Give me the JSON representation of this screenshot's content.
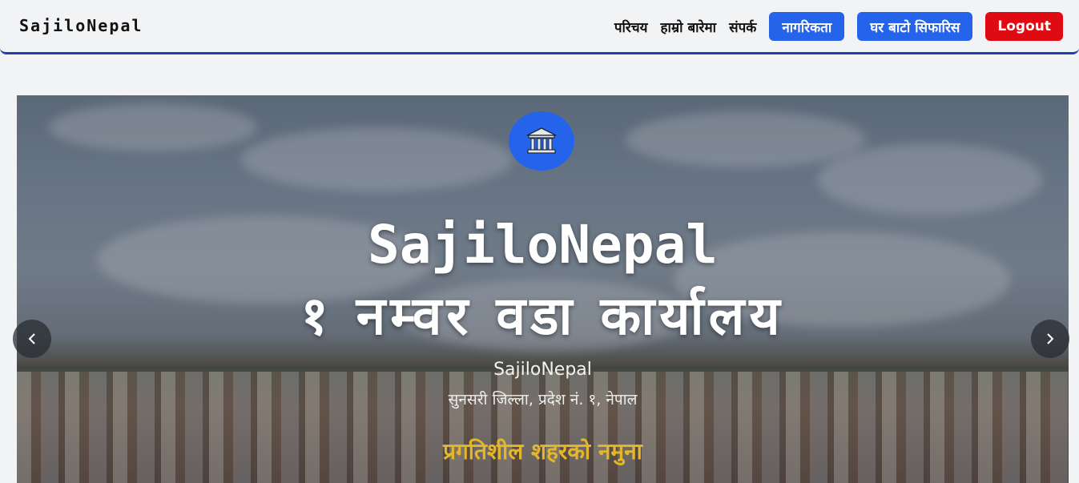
{
  "brand": "SajiloNepal",
  "nav": {
    "links": [
      "परिचय",
      "हाम्रो बारेमा",
      "संपर्क"
    ],
    "buttons": {
      "citizenship": "नागरिकता",
      "house_road": "घर बाटो सिफारिस",
      "logout": "Logout"
    }
  },
  "hero": {
    "emblem_icon": "government-building-icon",
    "title": "SajiloNepal",
    "subtitle": "१ नम्वर वडा कार्यालय",
    "name": "SajiloNepal",
    "address": "सुनसरी जिल्ला, प्रदेश नं. १, नेपाल",
    "tagline": "प्रगतिशील शहरको नमुना",
    "prev_icon": "chevron-left-icon",
    "next_icon": "chevron-right-icon"
  },
  "colors": {
    "primary": "#2563eb",
    "danger": "#e00b12",
    "nav_border": "#1e40af",
    "tagline": "#e2b72b"
  }
}
